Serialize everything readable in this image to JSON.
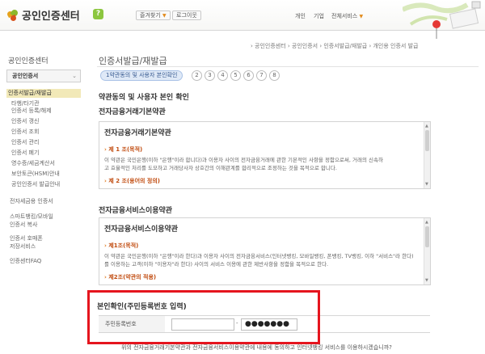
{
  "header": {
    "logo_text": "공인인증센터",
    "help_label": "?",
    "favorites_label": "즐겨찾기",
    "login_label": "로그이웃",
    "nav": [
      "개인",
      "기업",
      "전체서비스"
    ]
  },
  "sidebar": {
    "title": "공인인증센터",
    "category": "공인인증서",
    "sub_items": [
      "인증서발급/재발급",
      "타행/타기관",
      "인증서 등록/해제",
      "인증서 갱신",
      "인증서 조회",
      "인증서 관리",
      "인증서 폐기",
      "영수증/세금계산서",
      "보안토큰(HSM)안내",
      "공인인증서 발급안내"
    ],
    "main_items": [
      "전자세금용 인증서",
      "스마트뱅킹/모바일",
      "인증서 복사",
      "인증서 호매폰",
      "저장서비스",
      "인증센터FAQ"
    ]
  },
  "breadcrumb": "› 공인인증센터 › 공인인증서 › 인증서발급/재발급 › 개인용 인증서 발급",
  "page_title": "인증서발급/재발급",
  "steps": {
    "active_label": "1약관동의 및 사용자 본인확인",
    "numbers": [
      "2",
      "3",
      "4",
      "5",
      "6",
      "7",
      "8"
    ]
  },
  "section_heading": "약관동의 및 사용자 본인 확인",
  "terms1": {
    "heading": "전자금융거래기본약관",
    "box_title": "전자금융거래기본약관",
    "article1_head": "제 1 조(목적)",
    "article1_lines": [
      "이 약관은 국민은행(이하 \"은행\"이라 합니다)과 이용자 사이의 전자금융거래에 관한 기본적인 사항을 정함으로써, 거래의 신속하",
      "고 효율적인 처리를 도모하고 거래당사자 상호간의 이해관계를 합리적으로 조정하는 것을 목적으로 합니다."
    ],
    "article2_head": "제 2 조(용어의 정의)"
  },
  "terms2": {
    "heading": "전자금융서비스이용약관",
    "box_title": "전자금융서비스이용약관",
    "article1_head": "제1조(목적)",
    "article1_lines": [
      "이 약관은 국민은행(이하 \"은행\"이라 한다)과 이용자 사이의 전자금융서비스(인터넷뱅킹, 모바일뱅킹, 폰뱅킹, TV뱅킹, 이하 \"서비스\"라 한다)",
      "를 이용하는 고객(이하 \"이용자\"라 한다) 사이의 서비스 이용에 관한 제반사항을 정함을 목적으로 한다."
    ],
    "article2_head": "제2조(약관의 적용)"
  },
  "id_verify": {
    "heading": "본인확인(주민등록번호 입력)",
    "label": "주민등록번호",
    "front_value": "",
    "dash": "-",
    "back_value": "●●●●●●●"
  },
  "bottom_note": "위의 전자금융거래기본약관과 전자금융서비스이용약관에 내용에 동의하고 인터넷뱅킹 서비스를 이용하시겠습니까?",
  "colors": {
    "accent_orange": "#e6a21c",
    "article_red": "#c14c10",
    "highlight_red": "#e5151e",
    "active_sidebar": "#f2e9b8",
    "step_active_bg": "#dfe9f7"
  }
}
